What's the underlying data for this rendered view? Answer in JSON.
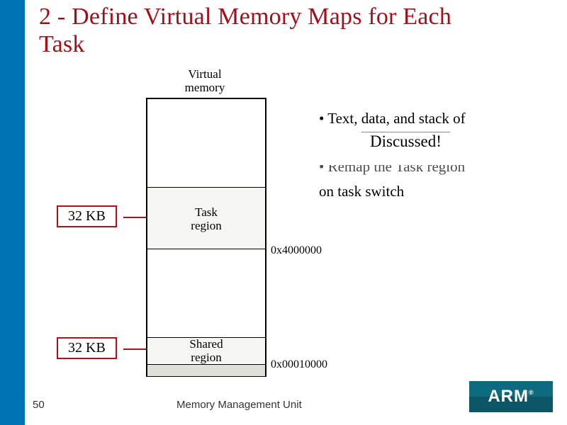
{
  "title_line1": "2 - Define Virtual Memory Maps for Each",
  "title_line2": "Task",
  "diagram": {
    "header_label": "Virtual\nmemory",
    "task_region_label": "Task\nregion",
    "task_region_addr": "0x4000000",
    "shared_region_label": "Shared\nregion",
    "shared_region_addr": "0x00010000",
    "task_size_label": "32 KB",
    "shared_size_label": "32 KB"
  },
  "bullets": {
    "b1": "• Text, data, and stack of",
    "discussed_overlay": "Discussed!",
    "b2_clipped": "• Remap the Task region",
    "b2_line2": "on task switch"
  },
  "footer": {
    "page_number": "50",
    "section": "Memory Management Unit",
    "logo_text": "ARM",
    "logo_reg": "®"
  }
}
